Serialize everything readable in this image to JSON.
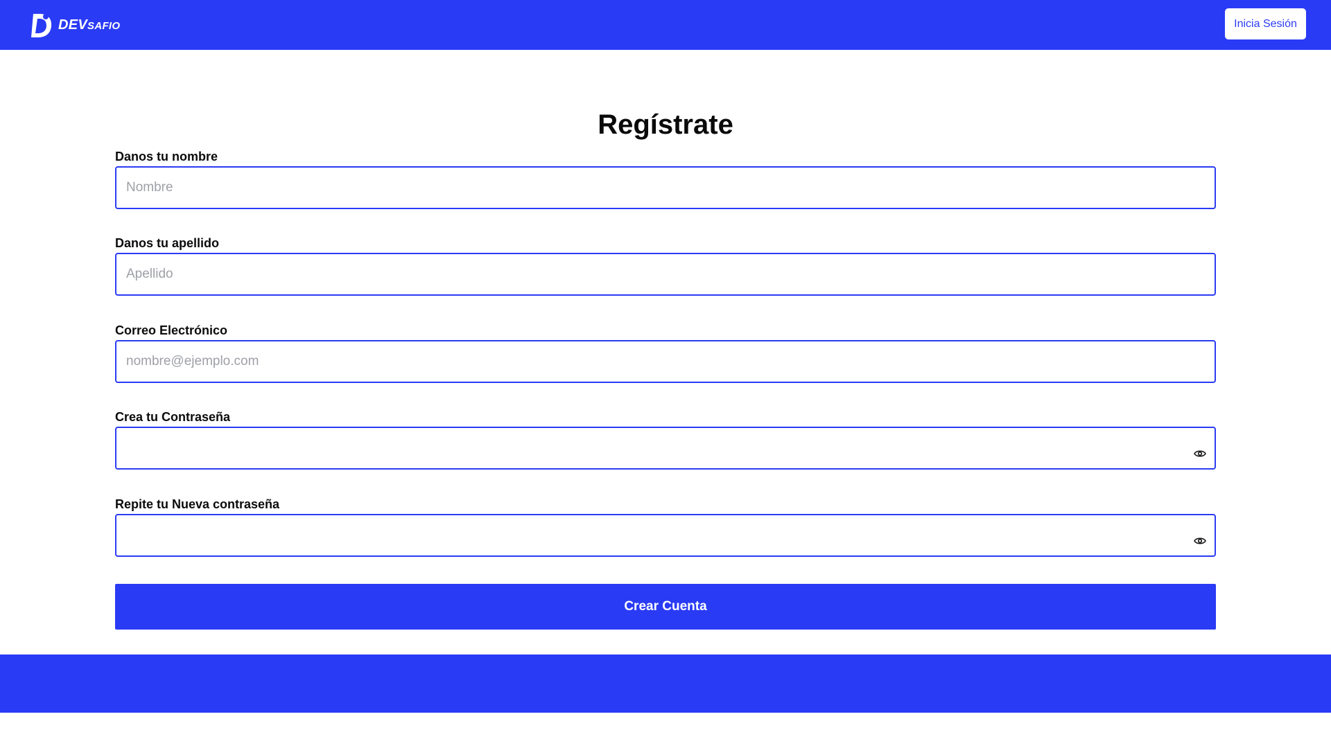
{
  "header": {
    "logo_main": "DEV",
    "logo_sub": "SAFIO",
    "login_button": "Inicia Sesión",
    "brand_color": "#2a3bf5"
  },
  "form": {
    "title": "Regístrate",
    "first_name": {
      "label": "Danos tu nombre",
      "placeholder": "Nombre",
      "value": ""
    },
    "last_name": {
      "label": "Danos tu apellido",
      "placeholder": "Apellido",
      "value": ""
    },
    "email": {
      "label": "Correo Electrónico",
      "placeholder": "nombre@ejemplo.com",
      "value": ""
    },
    "password": {
      "label": "Crea tu Contraseña",
      "placeholder": "",
      "value": "",
      "icon": "eye-icon"
    },
    "password_repeat": {
      "label": "Repite tu Nueva contraseña",
      "placeholder": "",
      "value": "",
      "icon": "eye-icon"
    },
    "submit_label": "Crear Cuenta"
  }
}
